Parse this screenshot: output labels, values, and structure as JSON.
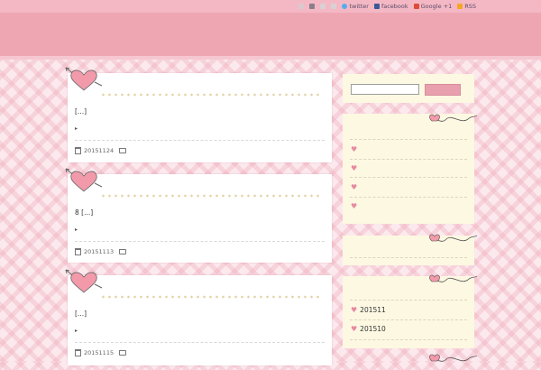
{
  "topbar": {
    "links": [
      {
        "name": "twitter",
        "label": "twitter",
        "color": "#55acee"
      },
      {
        "name": "facebook",
        "label": "facebook",
        "color": "#3b5998"
      },
      {
        "name": "googleplus",
        "label": "Google +1",
        "color": "#dd4b39"
      },
      {
        "name": "rss",
        "label": "RSS",
        "color": "#f5a623"
      }
    ]
  },
  "posts": [
    {
      "excerpt": "[...]",
      "bullet": "▸",
      "date": "20151124"
    },
    {
      "excerpt": "8 [...]",
      "bullet": "▸",
      "date": "20151113"
    },
    {
      "excerpt": "[...]",
      "bullet": "▸",
      "date": "20151115"
    }
  ],
  "sidebar": {
    "search": {
      "placeholder": "",
      "button_label": ""
    },
    "archives": [
      {
        "label": "201511"
      },
      {
        "label": "201510"
      }
    ]
  },
  "colors": {
    "heart": "#f29aaa",
    "accent": "#efa6b3",
    "widget_bg": "#fdf8e2"
  }
}
